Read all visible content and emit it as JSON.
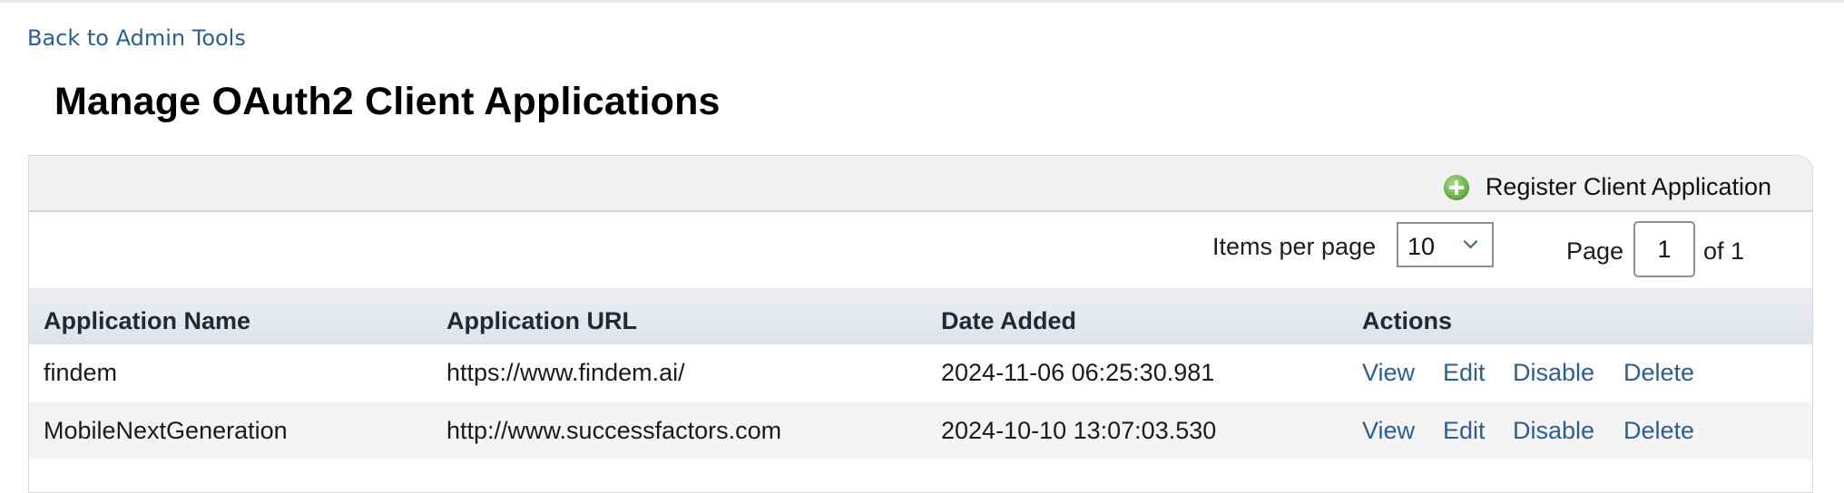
{
  "nav": {
    "back_link": "Back to Admin Tools"
  },
  "page": {
    "title": "Manage OAuth2 Client Applications"
  },
  "toolbar": {
    "register_label": "Register Client Application",
    "register_icon": "plus-circle-icon",
    "icon_color": "#6fb64b"
  },
  "pager": {
    "items_per_page_label": "Items per page",
    "items_per_page_value": "10",
    "page_label": "Page",
    "page_value": "1",
    "of_label": "of 1"
  },
  "table": {
    "headers": [
      "Application Name",
      "Application URL",
      "Date Added",
      "Actions"
    ],
    "rows": [
      {
        "name": "findem",
        "url": "https://www.findem.ai/",
        "date": "2024-11-06 06:25:30.981",
        "actions": [
          "View",
          "Edit",
          "Disable",
          "Delete"
        ]
      },
      {
        "name": "MobileNextGeneration",
        "url": "http://www.successfactors.com",
        "date": "2024-10-10 13:07:03.530",
        "actions": [
          "View",
          "Edit",
          "Disable",
          "Delete"
        ]
      }
    ]
  },
  "colors": {
    "link": "#2b5e93",
    "header_bg": "#dfe3e8",
    "toolbar_bg": "#f1f1f1"
  }
}
